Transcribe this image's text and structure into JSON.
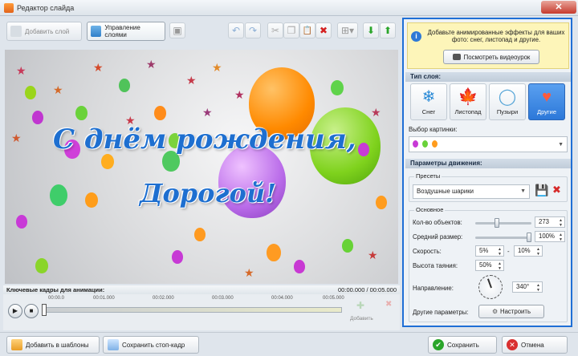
{
  "window": {
    "title": "Редактор слайда",
    "close_glyph": "✕"
  },
  "toolbar": {
    "add_layer": "Добавить слой",
    "manage_layers": "Управление слоями",
    "undo_glyph": "↶",
    "redo_glyph": "↷",
    "cut_glyph": "✂",
    "copy_glyph": "❐",
    "paste_glyph": "📋",
    "delete_glyph": "✖",
    "down_glyph": "⬇",
    "up_glyph": "⬆"
  },
  "canvas": {
    "line1": "С днём рождения,",
    "line2": "Дорогой!"
  },
  "timeline": {
    "title": "Ключевые кадры для анимации:",
    "time": "00:00.000 / 00:05.000",
    "ticks": [
      "00:00.0",
      "00:01.000",
      "00:02.000",
      "00:03.000",
      "00:04.000",
      "00:05.000"
    ],
    "add_label": "Добавить"
  },
  "bottom": {
    "add_template": "Добавить в шаблоны",
    "save_frame": "Сохранить стоп-кадр",
    "save": "Сохранить",
    "cancel": "Отмена"
  },
  "panel": {
    "tip": "Добавьте анимированные эффекты для ваших фото: снег, листопад и другие.",
    "video_button": "Посмотреть видеоурок",
    "layer_type_title": "Тип слоя:",
    "layer_types": [
      {
        "label": "Снег",
        "glyph": "❄"
      },
      {
        "label": "Листопад",
        "glyph": "🍁"
      },
      {
        "label": "Пузыри",
        "glyph": "◯"
      },
      {
        "label": "Другие",
        "glyph": "♥"
      }
    ],
    "picture_label": "Выбор картинки:",
    "motion_title": "Параметры движения:",
    "presets_label": "Пресеты",
    "preset_value": "Воздушные шарики",
    "basic_label": "Основное",
    "count_label": "Кол-во объектов:",
    "count_value": "273",
    "size_label": "Средний размер:",
    "size_value": "100%",
    "speed_label": "Скорость:",
    "speed_min": "5%",
    "speed_dash": "-",
    "speed_max": "10%",
    "melt_label": "Высота таяния:",
    "melt_value": "50%",
    "direction_label": "Направление:",
    "direction_value": "340°",
    "other_label": "Другие параметры:",
    "configure_button": "Настроить"
  },
  "colors": {
    "accent": "#1f6fd6",
    "selected_type": "#2c78d9"
  }
}
